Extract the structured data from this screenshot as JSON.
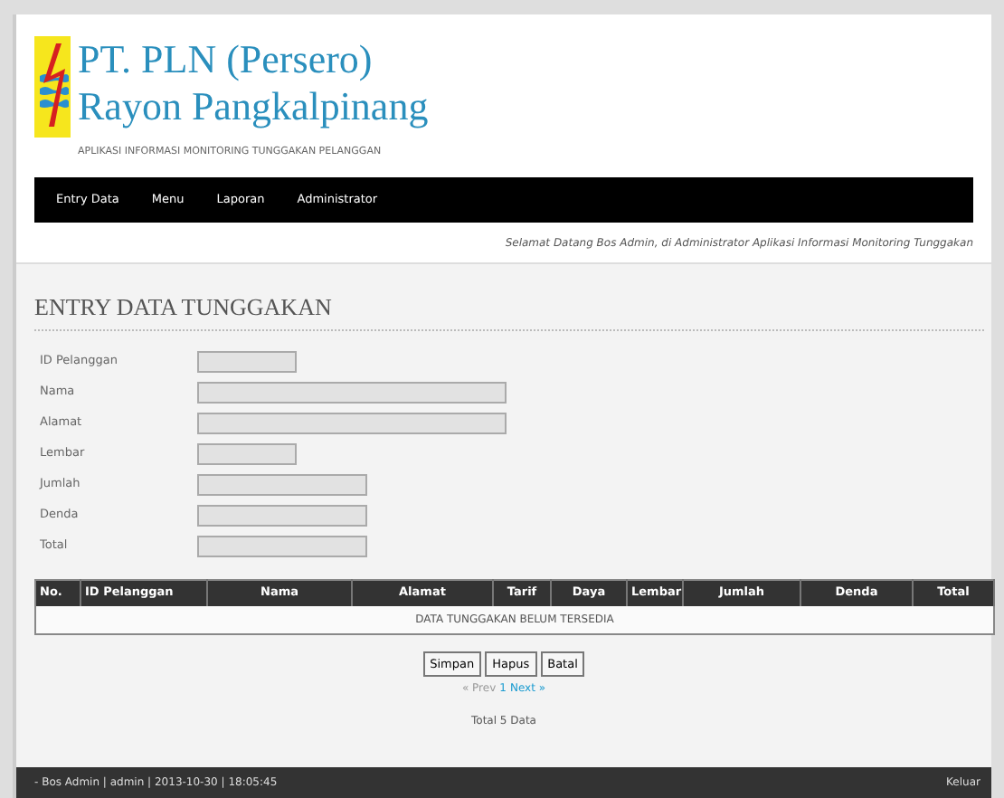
{
  "header": {
    "title_line_1": "PT. PLN (Persero)",
    "title_line_2": "Rayon Pangkalpinang",
    "subtitle": "APLIKASI INFORMASI MONITORING TUNGGAKAN PELANGGAN"
  },
  "menu": [
    {
      "label": "Entry Data"
    },
    {
      "label": "Menu"
    },
    {
      "label": "Laporan"
    },
    {
      "label": "Administrator"
    }
  ],
  "welcome": "Selamat Datang Bos Admin, di Administrator Aplikasi Informasi Monitoring Tunggakan",
  "page_title": "ENTRY DATA TUNGGAKAN",
  "form_fields": [
    {
      "label": "ID Pelanggan",
      "kind": "short"
    },
    {
      "label": "Nama",
      "kind": "long"
    },
    {
      "label": "Alamat",
      "kind": "long"
    },
    {
      "label": "Lembar",
      "kind": "short"
    },
    {
      "label": "Jumlah",
      "kind": "medium"
    },
    {
      "label": "Denda",
      "kind": "medium"
    },
    {
      "label": "Total",
      "kind": "medium"
    }
  ],
  "table": {
    "columns": [
      "No.",
      "ID Pelanggan",
      "Nama",
      "Alamat",
      "Tarif",
      "Daya",
      "Lembar",
      "Jumlah",
      "Denda",
      "Total"
    ],
    "empty_message": "DATA TUNGGAKAN BELUM TERSEDIA"
  },
  "buttons": [
    "Simpan",
    "Hapus",
    "Batal"
  ],
  "pagination": [
    {
      "label": "« Prev",
      "disabled": true
    },
    {
      "label": "1",
      "disabled": false
    },
    {
      "label": "Next »",
      "disabled": false
    }
  ],
  "total": "Total 5 Data",
  "footer": {
    "user_info": "- Bos Admin | admin | 2013-10-30 | 18:05:45",
    "logout": "Keluar"
  }
}
